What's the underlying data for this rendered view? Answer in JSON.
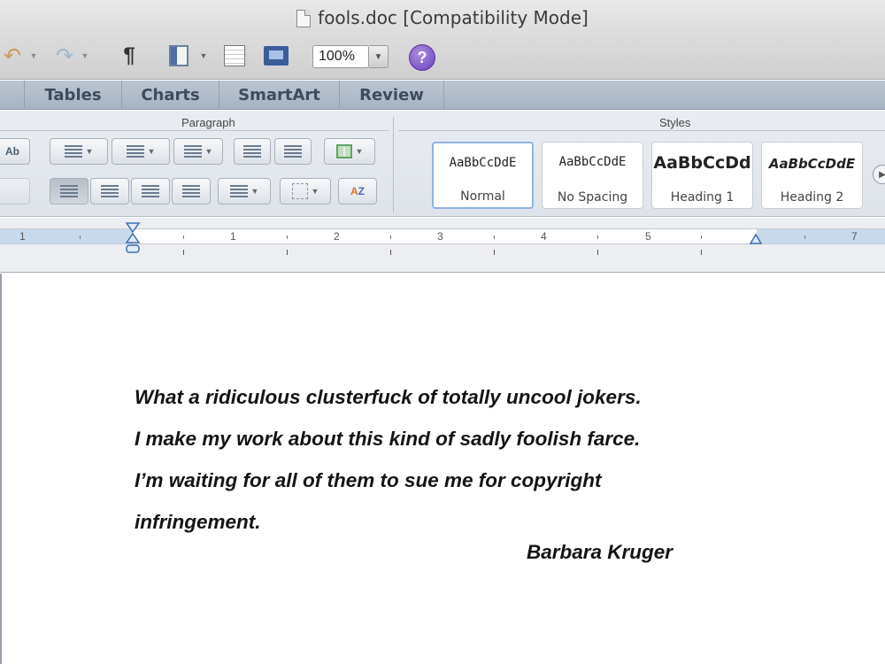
{
  "window": {
    "title": "fools.doc [Compatibility Mode]"
  },
  "toolbar": {
    "pilcrow": "¶",
    "zoom_value": "100%",
    "help_label": "?"
  },
  "ribbon_tabs": [
    "Tables",
    "Charts",
    "SmartArt",
    "Review"
  ],
  "groups": {
    "paragraph": "Paragraph",
    "styles": "Styles"
  },
  "styles_gallery": [
    {
      "sample": "AaBbCcDdE",
      "name": "Normal",
      "selected": true
    },
    {
      "sample": "AaBbCcDdE",
      "name": "No Spacing",
      "selected": false
    },
    {
      "sample": "AaBbCcDd",
      "name": "Heading 1",
      "selected": false
    },
    {
      "sample": "AaBbCcDdE",
      "name": "Heading 2",
      "selected": false
    }
  ],
  "ruler": {
    "numbers": [
      "1",
      "1",
      "2",
      "3",
      "4",
      "5",
      "7"
    ]
  },
  "document": {
    "lines": [
      "What a ridiculous clusterfuck of totally uncool jokers.",
      "I make my work about this kind of sadly foolish farce.",
      "I’m waiting for all of them to sue me for copyright",
      "infringement."
    ],
    "signature": "Barbara Kruger"
  }
}
